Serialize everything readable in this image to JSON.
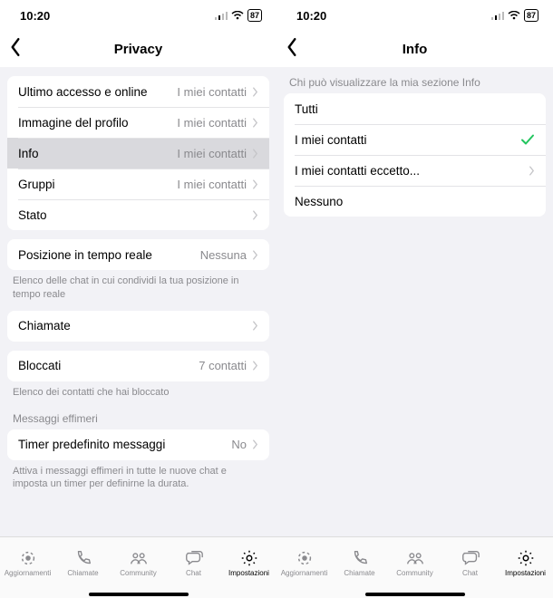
{
  "status": {
    "time": "10:20",
    "battery": "87"
  },
  "left": {
    "title": "Privacy",
    "groups": [
      {
        "rows": [
          {
            "label": "Ultimo accesso e online",
            "value": "I miei contatti",
            "chev": true
          },
          {
            "label": "Immagine del profilo",
            "value": "I miei contatti",
            "chev": true
          },
          {
            "label": "Info",
            "value": "I miei contatti",
            "chev": true,
            "selected": true
          },
          {
            "label": "Gruppi",
            "value": "I miei contatti",
            "chev": true
          },
          {
            "label": "Stato",
            "value": "",
            "chev": true
          }
        ]
      },
      {
        "rows": [
          {
            "label": "Posizione in tempo reale",
            "value": "Nessuna",
            "chev": true
          }
        ],
        "note": "Elenco delle chat in cui condividi la tua posizione in tempo reale"
      },
      {
        "rows": [
          {
            "label": "Chiamate",
            "value": "",
            "chev": true
          }
        ]
      },
      {
        "rows": [
          {
            "label": "Bloccati",
            "value": "7 contatti",
            "chev": true
          }
        ],
        "note": "Elenco dei contatti che hai bloccato"
      }
    ],
    "ephemeral_header": "Messaggi effimeri",
    "ephemeral": {
      "rows": [
        {
          "label": "Timer predefinito messaggi",
          "value": "No",
          "chev": true
        }
      ],
      "note": "Attiva i messaggi effimeri in tutte le nuove chat e imposta un timer per definirne la durata."
    }
  },
  "right": {
    "title": "Info",
    "header": "Chi può visualizzare la mia sezione Info",
    "options": [
      {
        "label": "Tutti",
        "checked": false,
        "chev": false
      },
      {
        "label": "I miei contatti",
        "checked": true,
        "chev": false
      },
      {
        "label": "I miei contatti eccetto...",
        "checked": false,
        "chev": true
      },
      {
        "label": "Nessuno",
        "checked": false,
        "chev": false
      }
    ]
  },
  "tabs": [
    {
      "label": "Aggiornamenti",
      "icon": "updates"
    },
    {
      "label": "Chiamate",
      "icon": "calls"
    },
    {
      "label": "Community",
      "icon": "community"
    },
    {
      "label": "Chat",
      "icon": "chat"
    },
    {
      "label": "Impostazioni",
      "icon": "settings",
      "active": true
    }
  ]
}
